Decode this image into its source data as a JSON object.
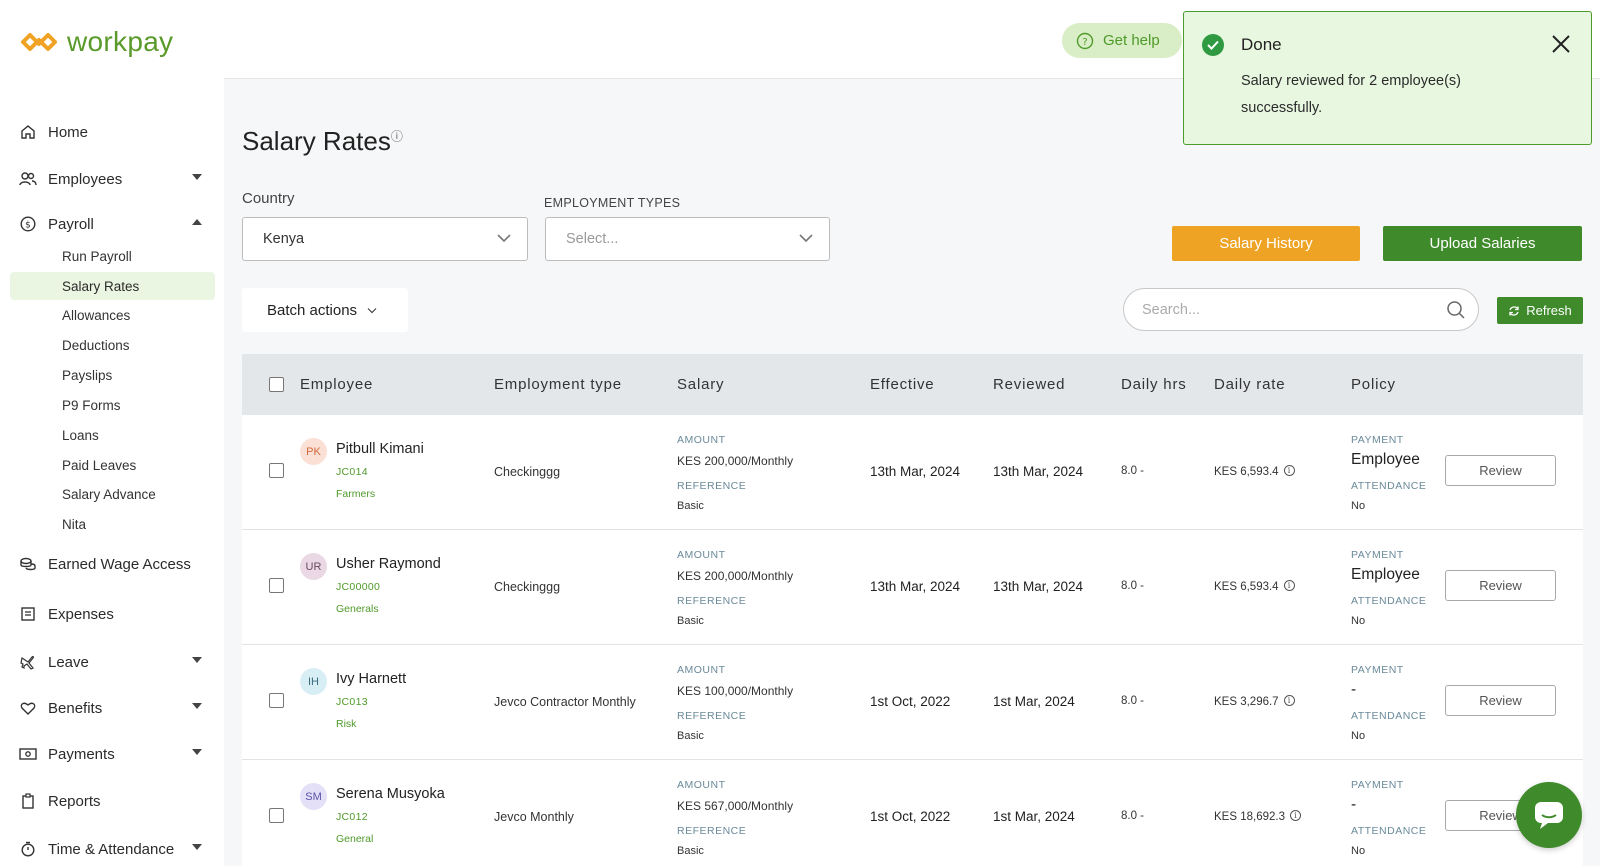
{
  "brand": {
    "name": "workpay"
  },
  "sidebar": {
    "items": [
      {
        "label": "Home",
        "icon": "home-icon"
      },
      {
        "label": "Employees",
        "icon": "users-icon"
      },
      {
        "label": "Payroll",
        "icon": "dollar-circle-icon"
      },
      {
        "label": "Earned Wage Access",
        "icon": "coins-icon"
      },
      {
        "label": "Expenses",
        "icon": "receipt-icon"
      },
      {
        "label": "Leave",
        "icon": "plane-icon"
      },
      {
        "label": "Benefits",
        "icon": "heart-icon"
      },
      {
        "label": "Payments",
        "icon": "cash-icon"
      },
      {
        "label": "Reports",
        "icon": "clipboard-icon"
      },
      {
        "label": "Time & Attendance",
        "icon": "stopwatch-icon"
      }
    ],
    "payroll_sub": [
      "Run Payroll",
      "Salary Rates",
      "Allowances",
      "Deductions",
      "Payslips",
      "P9 Forms",
      "Loans",
      "Paid Leaves",
      "Salary Advance",
      "Nita"
    ]
  },
  "header": {
    "help_label": "Get help"
  },
  "toast": {
    "title": "Done",
    "message": "Salary reviewed for 2 employee(s) successfully."
  },
  "page": {
    "title": "Salary Rates",
    "country_label": "Country",
    "country_value": "Kenya",
    "emp_types_label": "EMPLOYMENT TYPES",
    "emp_types_placeholder": "Select...",
    "salary_history": "Salary History",
    "upload_salaries": "Upload Salaries",
    "batch_actions": "Batch actions",
    "search_placeholder": "Search...",
    "refresh": "Refresh"
  },
  "table": {
    "headers": [
      "Employee",
      "Employment type",
      "Salary",
      "Effective",
      "Reviewed",
      "Daily hrs",
      "Daily rate",
      "Policy"
    ],
    "amount_label": "AMOUNT",
    "reference_label": "REFERENCE",
    "payment_label": "PAYMENT",
    "attendance_label": "ATTENDANCE",
    "review_label": "Review",
    "rows": [
      {
        "initials": "PK",
        "avatar_bg": "#fbe0d6",
        "avatar_fg": "#d5683f",
        "name": "Pitbull Kimani",
        "code": "JC014",
        "dept": "Farmers",
        "type": "Checkinggg",
        "amount": "KES 200,000/Monthly",
        "reference": "Basic",
        "effective": "13th Mar, 2024",
        "reviewed": "13th Mar, 2024",
        "hrs": "8.0 -",
        "rate": "KES 6,593.4",
        "payment": "Employee",
        "attendance": "No"
      },
      {
        "initials": "UR",
        "avatar_bg": "#ead9e4",
        "avatar_fg": "#6a4a5e",
        "name": "Usher Raymond",
        "code": "JC00000",
        "dept": "Generals",
        "type": "Checkinggg",
        "amount": "KES 200,000/Monthly",
        "reference": "Basic",
        "effective": "13th Mar, 2024",
        "reviewed": "13th Mar, 2024",
        "hrs": "8.0 -",
        "rate": "KES 6,593.4",
        "payment": "Employee",
        "attendance": "No"
      },
      {
        "initials": "IH",
        "avatar_bg": "#d8eef5",
        "avatar_fg": "#3a6a7a",
        "name": "Ivy Harnett",
        "code": "JC013",
        "dept": "Risk",
        "type": "Jevco Contractor Monthly",
        "amount": "KES 100,000/Monthly",
        "reference": "Basic",
        "effective": "1st Oct, 2022",
        "reviewed": "1st Mar, 2024",
        "hrs": "8.0 -",
        "rate": "KES 3,296.7",
        "payment": "-",
        "attendance": "No"
      },
      {
        "initials": "SM",
        "avatar_bg": "#e3e0f7",
        "avatar_fg": "#5a52a8",
        "name": "Serena Musyoka",
        "code": "JC012",
        "dept": "General",
        "type": "Jevco Monthly",
        "amount": "KES 567,000/Monthly",
        "reference": "Basic",
        "effective": "1st Oct, 2022",
        "reviewed": "1st Mar, 2024",
        "hrs": "8.0 -",
        "rate": "KES 18,692.3",
        "payment": "-",
        "attendance": "No"
      }
    ]
  },
  "colors": {
    "brand_green": "#3f8a2a",
    "accent_orange": "#efa324",
    "toast_bg": "#e8f7e0"
  }
}
